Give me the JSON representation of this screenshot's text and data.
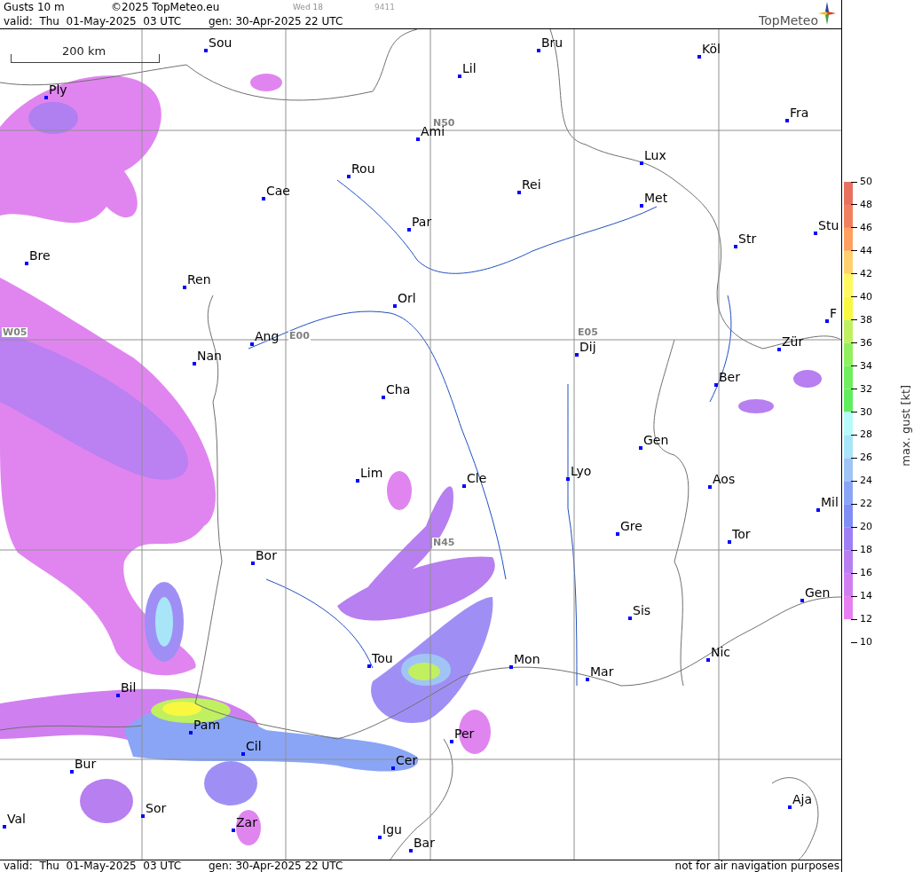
{
  "header": {
    "title": "Gusts 10 m",
    "copyright": "©2025 TopMeteo.eu",
    "run_label": "Wed 18",
    "code": "9411",
    "valid": "valid:  Thu  01-May-2025  03 UTC",
    "generated": "gen: 30-Apr-2025 22 UTC",
    "logo": "TopMeteo"
  },
  "map": {
    "scale": "200 km",
    "grid_labels": [
      "N50",
      "N45",
      "W05",
      "E00",
      "E05"
    ],
    "cities": [
      {
        "name": "Sou"
      },
      {
        "name": "Bru"
      },
      {
        "name": "Köl"
      },
      {
        "name": "Lil"
      },
      {
        "name": "Ply"
      },
      {
        "name": "Fra"
      },
      {
        "name": "Ami"
      },
      {
        "name": "Lux"
      },
      {
        "name": "Rou"
      },
      {
        "name": "Rei"
      },
      {
        "name": "Cae"
      },
      {
        "name": "Met"
      },
      {
        "name": "Par"
      },
      {
        "name": "Stu"
      },
      {
        "name": "Str"
      },
      {
        "name": "Bre"
      },
      {
        "name": "Ren"
      },
      {
        "name": "Orl"
      },
      {
        "name": "Ang"
      },
      {
        "name": "Dij"
      },
      {
        "name": "Zür"
      },
      {
        "name": "F"
      },
      {
        "name": "Nan"
      },
      {
        "name": "Ber"
      },
      {
        "name": "Cha"
      },
      {
        "name": "Gen"
      },
      {
        "name": "Lim"
      },
      {
        "name": "Cle"
      },
      {
        "name": "Lyo"
      },
      {
        "name": "Aos"
      },
      {
        "name": "Mil"
      },
      {
        "name": "Gre"
      },
      {
        "name": "Tor"
      },
      {
        "name": "Bor"
      },
      {
        "name": "Gen"
      },
      {
        "name": "Sis"
      },
      {
        "name": "Nic"
      },
      {
        "name": "Tou"
      },
      {
        "name": "Mon"
      },
      {
        "name": "Mar"
      },
      {
        "name": "Bil"
      },
      {
        "name": "Pam"
      },
      {
        "name": "Per"
      },
      {
        "name": "Cil"
      },
      {
        "name": "Cer"
      },
      {
        "name": "Bur"
      },
      {
        "name": "Sor"
      },
      {
        "name": "Aja"
      },
      {
        "name": "Val"
      },
      {
        "name": "Zar"
      },
      {
        "name": "Igu"
      },
      {
        "name": "Bar"
      }
    ]
  },
  "legend": {
    "title": "max. gust [kt]",
    "ticks": [
      "50",
      "48",
      "46",
      "44",
      "42",
      "40",
      "38",
      "36",
      "34",
      "32",
      "30",
      "28",
      "26",
      "24",
      "22",
      "20",
      "18",
      "16",
      "14",
      "12",
      "10"
    ],
    "bands": [
      {
        "color": "#e87060"
      },
      {
        "color": "#f08060"
      },
      {
        "color": "#ffa060"
      },
      {
        "color": "#ffd070"
      },
      {
        "color": "#fff860"
      },
      {
        "color": "#f8f840"
      },
      {
        "color": "#c0f060"
      },
      {
        "color": "#90f060"
      },
      {
        "color": "#70ee60"
      },
      {
        "color": "#60ee60"
      },
      {
        "color": "#b8fafa"
      },
      {
        "color": "#a8e5f8"
      },
      {
        "color": "#a0c5f5"
      },
      {
        "color": "#8aa5f5"
      },
      {
        "color": "#7f8ff5"
      },
      {
        "color": "#9f7ff5"
      },
      {
        "color": "#b77ff0"
      },
      {
        "color": "#d07ff0"
      },
      {
        "color": "#e87ff0"
      }
    ]
  },
  "footer": {
    "valid": "valid:  Thu  01-May-2025  03 UTC",
    "generated": "gen: 30-Apr-2025 22 UTC",
    "notice": "not for air navigation purposes"
  }
}
